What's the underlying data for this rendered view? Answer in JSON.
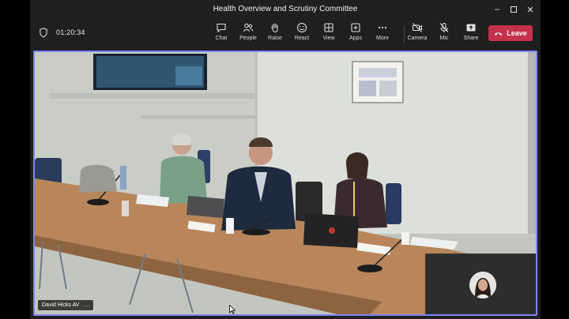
{
  "window": {
    "title": "Health Overview and Scrutiny Committee",
    "minimize_icon": "minimize-icon",
    "maximize_icon": "maximize-icon",
    "close_icon": "close-icon"
  },
  "meeting": {
    "elapsed_time": "01:20:34",
    "security_icon": "shield-icon"
  },
  "toolbar": {
    "items": [
      {
        "label": "Chat",
        "icon": "chat-icon"
      },
      {
        "label": "People",
        "icon": "people-icon"
      },
      {
        "label": "Raise",
        "icon": "raise-hand-icon"
      },
      {
        "label": "React",
        "icon": "react-icon"
      },
      {
        "label": "View",
        "icon": "view-grid-icon"
      },
      {
        "label": "Apps",
        "icon": "apps-plus-icon"
      },
      {
        "label": "More",
        "icon": "more-dots-icon"
      },
      {
        "label": "Camera",
        "icon": "camera-off-icon"
      },
      {
        "label": "Mic",
        "icon": "mic-off-icon"
      },
      {
        "label": "Share",
        "icon": "share-icon"
      }
    ],
    "leave_label": "Leave",
    "leave_color": "#c4314b"
  },
  "stage": {
    "active_speaker_name": "David Hicks AV",
    "name_menu": "…",
    "frame_color": "#7f85f5",
    "table_placards": [
      "Adrian Wallis",
      "Cllr ...",
      "Lesley Bowden"
    ]
  }
}
